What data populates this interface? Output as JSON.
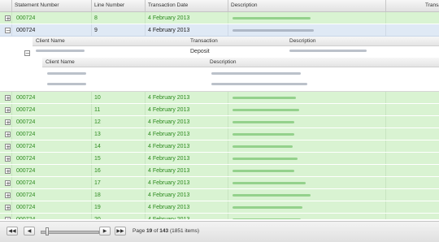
{
  "columns": [
    "Statement Number",
    "Line Number",
    "Transaction Date",
    "Description",
    "Transa"
  ],
  "top_row": {
    "statement": "000724",
    "line": "8",
    "date": "4 February 2013"
  },
  "expanded_row": {
    "statement": "000724",
    "line": "9",
    "date": "4 February 2013",
    "toggle": "−"
  },
  "detail": {
    "headers": [
      "Client Name",
      "Transaction",
      "Description"
    ],
    "transaction": "Deposit",
    "toggle": "−",
    "nested_headers": [
      "Client Name",
      "Description"
    ]
  },
  "rows": [
    {
      "statement": "000724",
      "line": "10",
      "date": "4 February 2013"
    },
    {
      "statement": "000724",
      "line": "11",
      "date": "4 February 2013"
    },
    {
      "statement": "000724",
      "line": "12",
      "date": "4 February 2013"
    },
    {
      "statement": "000724",
      "line": "13",
      "date": "4 February 2013"
    },
    {
      "statement": "000724",
      "line": "14",
      "date": "4 February 2013"
    },
    {
      "statement": "000724",
      "line": "15",
      "date": "4 February 2013"
    },
    {
      "statement": "000724",
      "line": "16",
      "date": "4 February 2013"
    },
    {
      "statement": "000724",
      "line": "17",
      "date": "4 February 2013"
    },
    {
      "statement": "000724",
      "line": "18",
      "date": "4 February 2013"
    },
    {
      "statement": "000724",
      "line": "19",
      "date": "4 February 2013"
    },
    {
      "statement": "000724",
      "line": "20",
      "date": "4 February 2013"
    }
  ],
  "row_toggle": "+",
  "pager": {
    "first": "◀◀",
    "prev": "◀",
    "next": "▶",
    "last": "▶▶",
    "page_prefix": "Page ",
    "page": "19",
    "page_of": " of ",
    "total_pages": "143",
    "items": " (1851 items)"
  }
}
